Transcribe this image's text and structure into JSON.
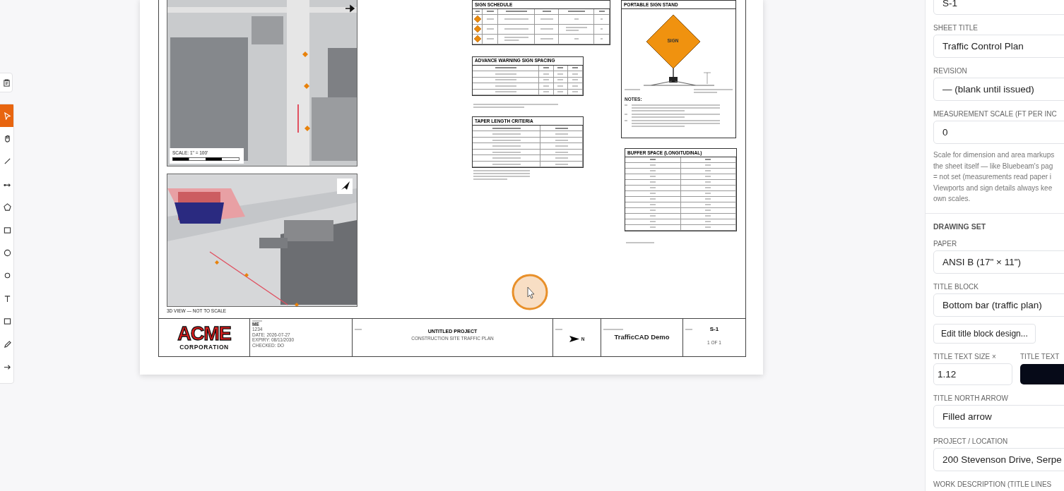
{
  "toolbar": {
    "tools": [
      {
        "selected": true
      },
      {
        "selected": false
      },
      {
        "selected": false
      },
      {
        "selected": false
      },
      {
        "selected": false
      },
      {
        "selected": false
      },
      {
        "selected": false
      },
      {
        "selected": false
      },
      {
        "selected": false
      },
      {
        "selected": false
      },
      {
        "selected": false
      },
      {
        "selected": false
      }
    ]
  },
  "sheet": {
    "plan_map": {
      "scale_label": "SCALE: 1\" = 100'"
    },
    "view_3d": {
      "caption": "3D VIEW — NOT TO SCALE"
    },
    "sign_schedule": {
      "title": "SIGN SCHEDULE"
    },
    "advance_spacing": {
      "title": "ADVANCE WARNING SIGN SPACING"
    },
    "taper": {
      "title": "TAPER LENGTH CRITERIA"
    },
    "sign_stand": {
      "title": "PORTABLE SIGN STAND",
      "sign_text": "SIGN",
      "notes_label": "NOTES:"
    },
    "buffer": {
      "title": "BUFFER SPACE (LONGITUDINAL)"
    },
    "title_block": {
      "logo_main": "ACME",
      "logo_sub": "CORPORATION",
      "drawn_lines": [
        "ME",
        "1234",
        "DATE: 2026-07-27",
        "EXPIRY: 08/11/2030",
        "CHECKED: DO"
      ],
      "project": "UNTITLED PROJECT",
      "subtitle": "CONSTRUCTION SITE TRAFFIC PLAN",
      "north": "N",
      "company": "TrafficCAD Demo",
      "sheet": "S-1",
      "sheet_of": "1 OF 1"
    }
  },
  "panel": {
    "items": [
      {
        "kind": "input",
        "value": "S-1"
      },
      {
        "kind": "label",
        "text": "SHEET TITLE"
      },
      {
        "kind": "input",
        "value": "Traffic Control Plan"
      },
      {
        "kind": "label",
        "text": "REVISION"
      },
      {
        "kind": "input",
        "value": "— (blank until issued)"
      },
      {
        "kind": "label",
        "text": "MEASUREMENT SCALE (FT PER INC"
      },
      {
        "kind": "input",
        "value": "0"
      },
      {
        "kind": "help",
        "text": "Scale for dimension and area markups\nthe sheet itself — like Bluebeam's pag\n= not set (measurements read paper i\nViewports and sign details always kee\nown scales."
      },
      {
        "kind": "divider"
      },
      {
        "kind": "section",
        "text": "DRAWING SET"
      },
      {
        "kind": "label",
        "text": "PAPER"
      },
      {
        "kind": "select",
        "value": "ANSI B (17\" × 11\")"
      },
      {
        "kind": "label",
        "text": "TITLE BLOCK"
      },
      {
        "kind": "select",
        "value": "Bottom bar (traffic plan)"
      },
      {
        "kind": "button",
        "text": "Edit title block design..."
      },
      {
        "kind": "pair",
        "labels": [
          "TITLE TEXT SIZE ×",
          "TITLE TEXT"
        ],
        "value": "1.12",
        "color": "#060a18"
      },
      {
        "kind": "label",
        "text": "TITLE NORTH ARROW"
      },
      {
        "kind": "select",
        "value": "Filled arrow"
      },
      {
        "kind": "label",
        "text": "PROJECT / LOCATION"
      },
      {
        "kind": "input",
        "value": "200 Stevenson Drive, Serpe"
      },
      {
        "kind": "label",
        "text": "WORK DESCRIPTION (TITLE LINES"
      }
    ]
  }
}
